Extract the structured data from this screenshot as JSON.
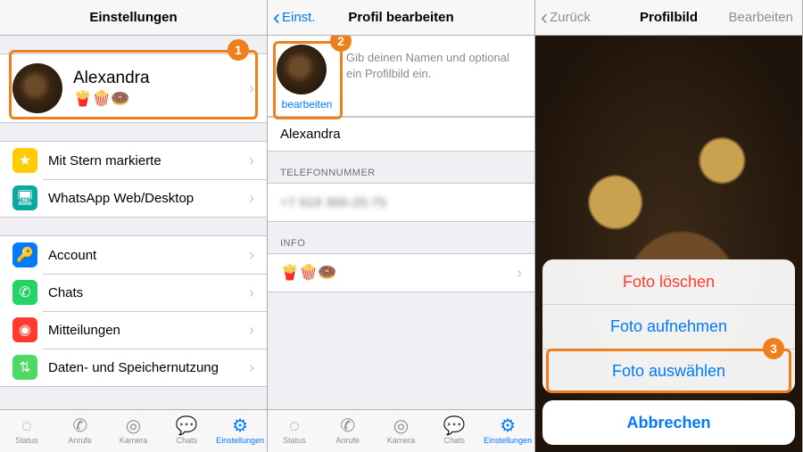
{
  "screen1": {
    "nav_title": "Einstellungen",
    "profile": {
      "name": "Alexandra",
      "status": "🍟🍿🍩"
    },
    "group_a": [
      {
        "icon": "star-icon",
        "color": "ic-yellow",
        "glyph": "★",
        "label": "Mit Stern markierte"
      },
      {
        "icon": "desktop-icon",
        "color": "ic-teal",
        "glyph": "🖥",
        "label": "WhatsApp Web/Desktop"
      }
    ],
    "group_b": [
      {
        "icon": "key-icon",
        "color": "ic-blue",
        "glyph": "🔑",
        "label": "Account"
      },
      {
        "icon": "whatsapp-icon",
        "color": "ic-green",
        "glyph": "✆",
        "label": "Chats"
      },
      {
        "icon": "notify-icon",
        "color": "ic-red",
        "glyph": "◉",
        "label": "Mitteilungen"
      },
      {
        "icon": "data-icon",
        "color": "ic-lime",
        "glyph": "⇅",
        "label": "Daten- und Speichernutzung"
      }
    ],
    "callout_badge": "1"
  },
  "tabbar": [
    {
      "name": "tab-status",
      "glyph": "◌",
      "label": "Status"
    },
    {
      "name": "tab-calls",
      "glyph": "✆",
      "label": "Anrufe"
    },
    {
      "name": "tab-camera",
      "glyph": "◎",
      "label": "Kamera"
    },
    {
      "name": "tab-chats",
      "glyph": "💬",
      "label": "Chats"
    },
    {
      "name": "tab-settings",
      "glyph": "⚙",
      "label": "Einstellungen"
    }
  ],
  "screen2": {
    "nav_back": "Einst.",
    "nav_title": "Profil bearbeiten",
    "hint": "Gib deinen Namen und optional ein Profilbild ein.",
    "edit_link": "bearbeiten",
    "name_value": "Alexandra",
    "section_phone": "TELEFONNUMMER",
    "phone_value": "+7 919 300-25-75",
    "section_info": "INFO",
    "info_value": "🍟🍿🍩",
    "callout_badge": "2"
  },
  "screen3": {
    "nav_back": "Zurück",
    "nav_title": "Profilbild",
    "nav_right": "Bearbeiten",
    "sheet": {
      "delete": "Foto löschen",
      "take": "Foto aufnehmen",
      "choose": "Foto auswählen",
      "cancel": "Abbrechen"
    },
    "callout_badge": "3"
  }
}
